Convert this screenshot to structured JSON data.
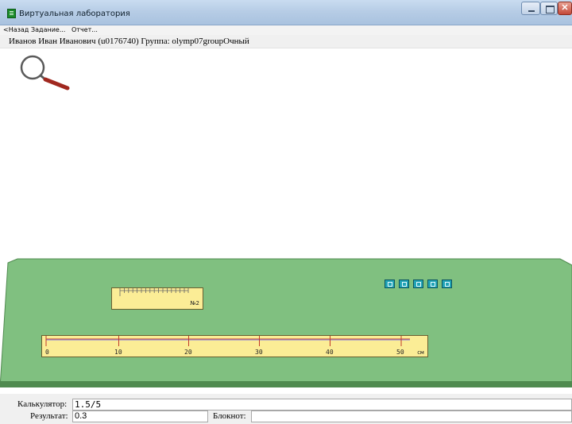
{
  "window": {
    "title": "Виртуальная лаборатория",
    "close_glyph": "✕"
  },
  "menu": {
    "back": "<Назад",
    "task": "Задание...",
    "report": "Отчет..."
  },
  "user_info": "Иванов Иван Иванович (u0176740)  Группа: olymp07groupОчный",
  "small_ruler": {
    "label": "№2"
  },
  "big_ruler": {
    "ticks": [
      "0",
      "10",
      "20",
      "30",
      "40",
      "50"
    ],
    "unit": "см"
  },
  "weights": {
    "count": 5,
    "color": "#21a3b6"
  },
  "bottom": {
    "calculator_label": "Калькулятор:",
    "calculator_value": "1.5/5",
    "result_label": "Результат:",
    "result_value": "0.3",
    "notes_label": "Блокнот:",
    "notes_value": ""
  },
  "colors": {
    "table_green": "#80c080",
    "table_edge": "#4f8a4f",
    "ruler_yellow": "#fbed96",
    "tick_red": "#c0392b"
  }
}
